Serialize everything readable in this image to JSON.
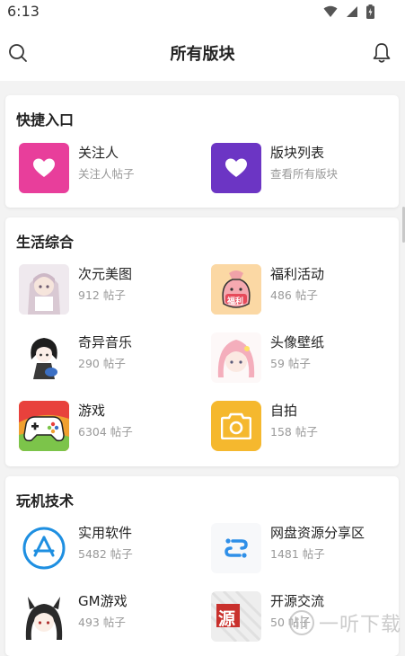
{
  "status_bar": {
    "time": "6:13"
  },
  "header": {
    "title": "所有版块"
  },
  "sections": [
    {
      "title": "快捷入口",
      "items": [
        {
          "name": "关注人",
          "sub": "关注人帖子",
          "icon": "heart-icon",
          "color": "#e83e9b"
        },
        {
          "name": "版块列表",
          "sub": "查看所有版块",
          "icon": "heart-icon",
          "color": "#6c35c4"
        }
      ]
    },
    {
      "title": "生活综合",
      "items": [
        {
          "name": "次元美图",
          "sub": "912 帖子",
          "icon": "anime-girl-thumbnail"
        },
        {
          "name": "福利活动",
          "sub": "486 帖子",
          "icon": "money-bag-thumbnail",
          "badge": "福利"
        },
        {
          "name": "奇异音乐",
          "sub": "290 帖子",
          "icon": "anime-guitar-thumbnail"
        },
        {
          "name": "头像壁纸",
          "sub": "59 帖子",
          "icon": "anime-pink-hair-thumbnail"
        },
        {
          "name": "游戏",
          "sub": "6304 帖子",
          "icon": "gamepad-thumbnail"
        },
        {
          "name": "自拍",
          "sub": "158 帖子",
          "icon": "camera-thumbnail",
          "color": "#f5b82e"
        }
      ]
    },
    {
      "title": "玩机技术",
      "items": [
        {
          "name": "实用软件",
          "sub": "5482 帖子",
          "icon": "app-store-icon",
          "color": "#1e8fe1"
        },
        {
          "name": "网盘资源分享区",
          "sub": "1481 帖子",
          "icon": "link-icon",
          "color": "#2f8fe8"
        },
        {
          "name": "GM游戏",
          "sub": "493 帖子",
          "icon": "anime-catgirl-thumbnail"
        },
        {
          "name": "开源交流",
          "sub": "50 帖子",
          "icon": "source-stamp-thumbnail",
          "badge": "源"
        }
      ]
    }
  ],
  "watermark": {
    "text": "一听下载"
  }
}
